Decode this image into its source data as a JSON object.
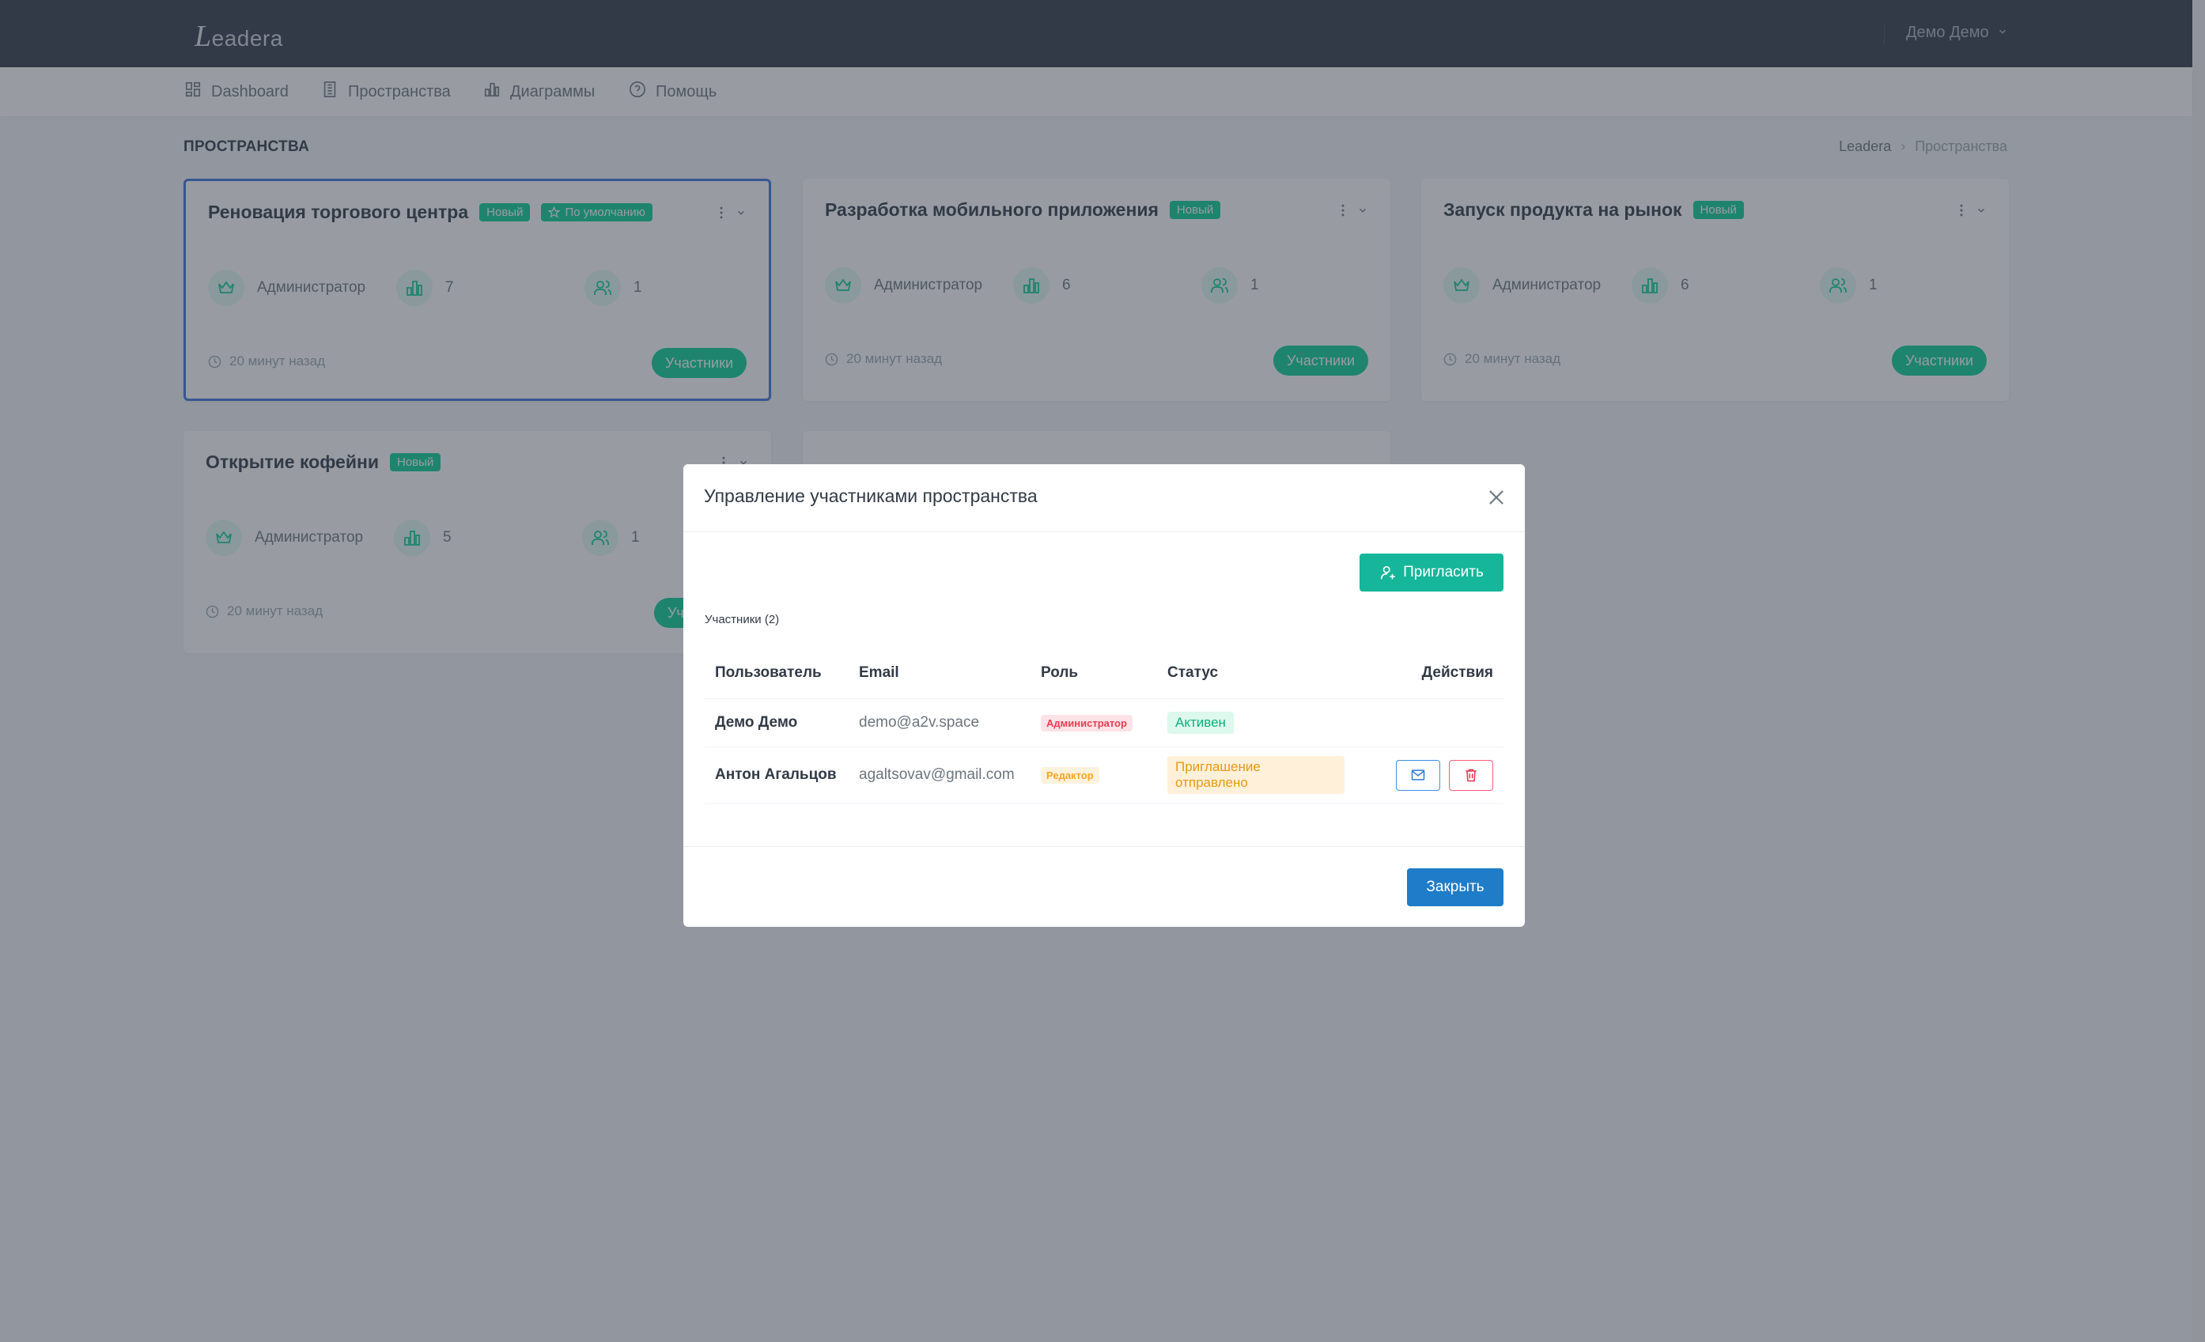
{
  "header": {
    "logo_initial": "L",
    "logo_rest": "eadera",
    "user_name": "Демо Демо"
  },
  "nav": {
    "items": [
      {
        "label": "Dashboard",
        "icon": "dashboard-icon"
      },
      {
        "label": "Пространства",
        "icon": "building-icon"
      },
      {
        "label": "Диаграммы",
        "icon": "bar-chart-icon"
      },
      {
        "label": "Помощь",
        "icon": "help-circle-icon"
      }
    ]
  },
  "page": {
    "title": "ПРОСТРАНСТВА",
    "breadcrumb": [
      "Leadera",
      "Пространства"
    ]
  },
  "cards": [
    {
      "title": "Реновация торгового центра",
      "badge_new": "Новый",
      "badge_default": "По умолчанию",
      "role": "Администратор",
      "charts": "7",
      "members": "1",
      "time": "20 минут назад",
      "button": "Участники"
    },
    {
      "title": "Разработка мобильного приложения",
      "badge_new": "Новый",
      "role": "Администратор",
      "charts": "6",
      "members": "1",
      "time": "20 минут назад",
      "button": "Участники"
    },
    {
      "title": "Запуск продукта на рынок",
      "badge_new": "Новый",
      "role": "Администратор",
      "charts": "6",
      "members": "1",
      "time": "20 минут назад",
      "button": "Участники"
    },
    {
      "title": "Открытие кофейни",
      "badge_new": "Новый",
      "role": "Администратор",
      "charts": "5",
      "members": "1",
      "time": "20 минут назад",
      "button": "Участники"
    }
  ],
  "modal": {
    "title": "Управление участниками пространства",
    "invite_button": "Пригласить",
    "members_count": "Участники (2)",
    "columns": {
      "user": "Пользователь",
      "email": "Email",
      "role": "Роль",
      "status": "Статус",
      "actions": "Действия"
    },
    "rows": [
      {
        "user": "Демо Демо",
        "email": "demo@a2v.space",
        "role": "Администратор",
        "status": "Активен"
      },
      {
        "user": "Антон Агальцов",
        "email": "agaltsovav@gmail.com",
        "role": "Редактор",
        "status": "Приглашение отправлено"
      }
    ],
    "close_button": "Закрыть"
  },
  "colors": {
    "accent_green": "#0acf97",
    "invite_teal": "#15b69a",
    "close_blue": "#1f7cc9",
    "topbar": "#313a46",
    "selected_border": "#3d73dd"
  }
}
